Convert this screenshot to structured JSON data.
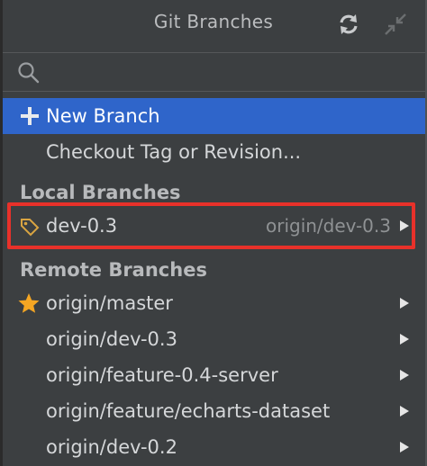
{
  "header": {
    "title": "Git Branches",
    "refresh_icon": "refresh-icon",
    "collapse_icon": "collapse-icon"
  },
  "search": {
    "value": "",
    "placeholder": "",
    "icon": "search-icon"
  },
  "actions": [
    {
      "label": "New Branch",
      "icon": "plus-icon",
      "selected": true
    },
    {
      "label": "Checkout Tag or Revision...",
      "selected": false
    }
  ],
  "local": {
    "header": "Local Branches",
    "branches": [
      {
        "name": "dev-0.3",
        "tracking": "origin/dev-0.3",
        "icon": "tag-icon",
        "highlighted": true
      }
    ]
  },
  "remote": {
    "header": "Remote Branches",
    "branches": [
      {
        "name": "origin/master",
        "icon": "star-icon",
        "favorite": true
      },
      {
        "name": "origin/dev-0.3"
      },
      {
        "name": "origin/feature-0.4-server"
      },
      {
        "name": "origin/feature/echarts-dataset"
      },
      {
        "name": "origin/dev-0.2"
      }
    ]
  },
  "colors": {
    "background": "#3c3f41",
    "selection": "#2f65ca",
    "highlight_box": "#e8312a",
    "favorite_star": "#f5a623"
  }
}
